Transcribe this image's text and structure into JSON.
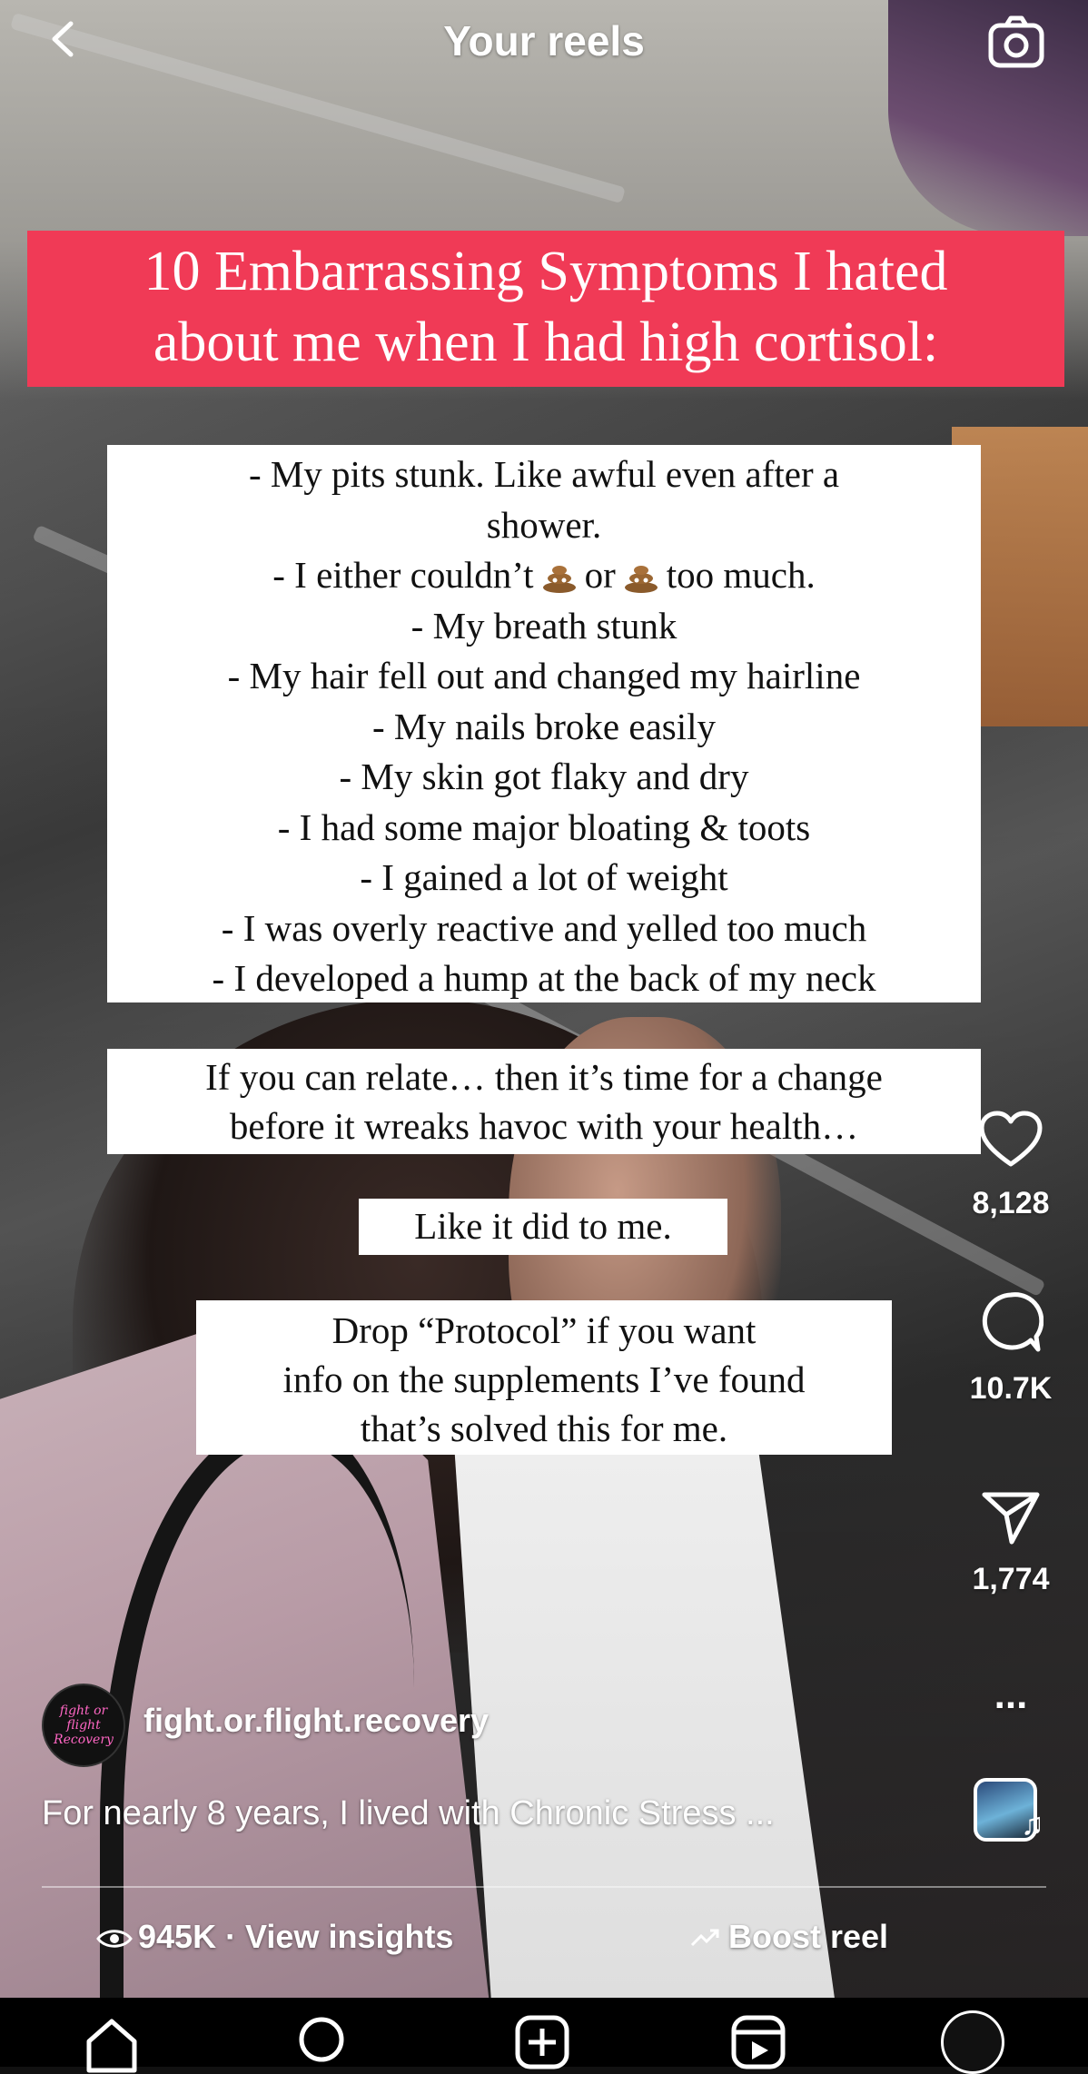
{
  "header": {
    "title": "Your reels"
  },
  "overlay": {
    "banner_line1": "10 Embarrassing Symptoms I hated",
    "banner_line2": "about me when I had high cortisol:",
    "symptoms": [
      "- My pits stunk. Like awful even after a",
      "shower.",
      "- I either couldn’t",
      "or",
      "too much.",
      "- My breath stunk",
      "- My hair fell out and changed my hairline",
      "- My nails broke easily",
      "- My skin got flaky and dry",
      "- I had some major bloating & toots",
      "- I gained a lot of weight",
      "- I was overly reactive and yelled too much",
      "- I developed a hump at the back of my neck"
    ],
    "relate_line1": "If you can relate… then it’s time for a change",
    "relate_line2": "before it wreaks havoc with your health…",
    "like_it": "Like it did to me.",
    "drop_line1": "Drop “Protocol” if you want",
    "drop_line2": "info on the supplements I’ve found",
    "drop_line3": "that’s solved this for me."
  },
  "actions": {
    "likes": "8,128",
    "comments": "10.7K",
    "shares": "1,774",
    "more": "..."
  },
  "post": {
    "avatar_text": "fight or flight Recovery",
    "username": "fight.or.flight.recovery",
    "caption": "For nearly 8 years, I lived with Chronic Stress ...",
    "views": "945K · View insights",
    "boost": "Boost reel"
  },
  "icons": {
    "back": "chevron-left-icon",
    "camera": "camera-icon",
    "like": "heart-icon",
    "comment": "comment-bubble-icon",
    "share": "send-icon",
    "more": "ellipsis-icon",
    "eye": "eye-icon",
    "boost": "trend-arrow-icon",
    "poop": "poop-emoji-icon",
    "tabs": [
      "home-icon",
      "search-icon",
      "create-icon",
      "reels-icon",
      "profile-avatar"
    ]
  },
  "colors": {
    "banner": "#f03a56",
    "text": "#ffffff",
    "tabbar": "#000000"
  }
}
